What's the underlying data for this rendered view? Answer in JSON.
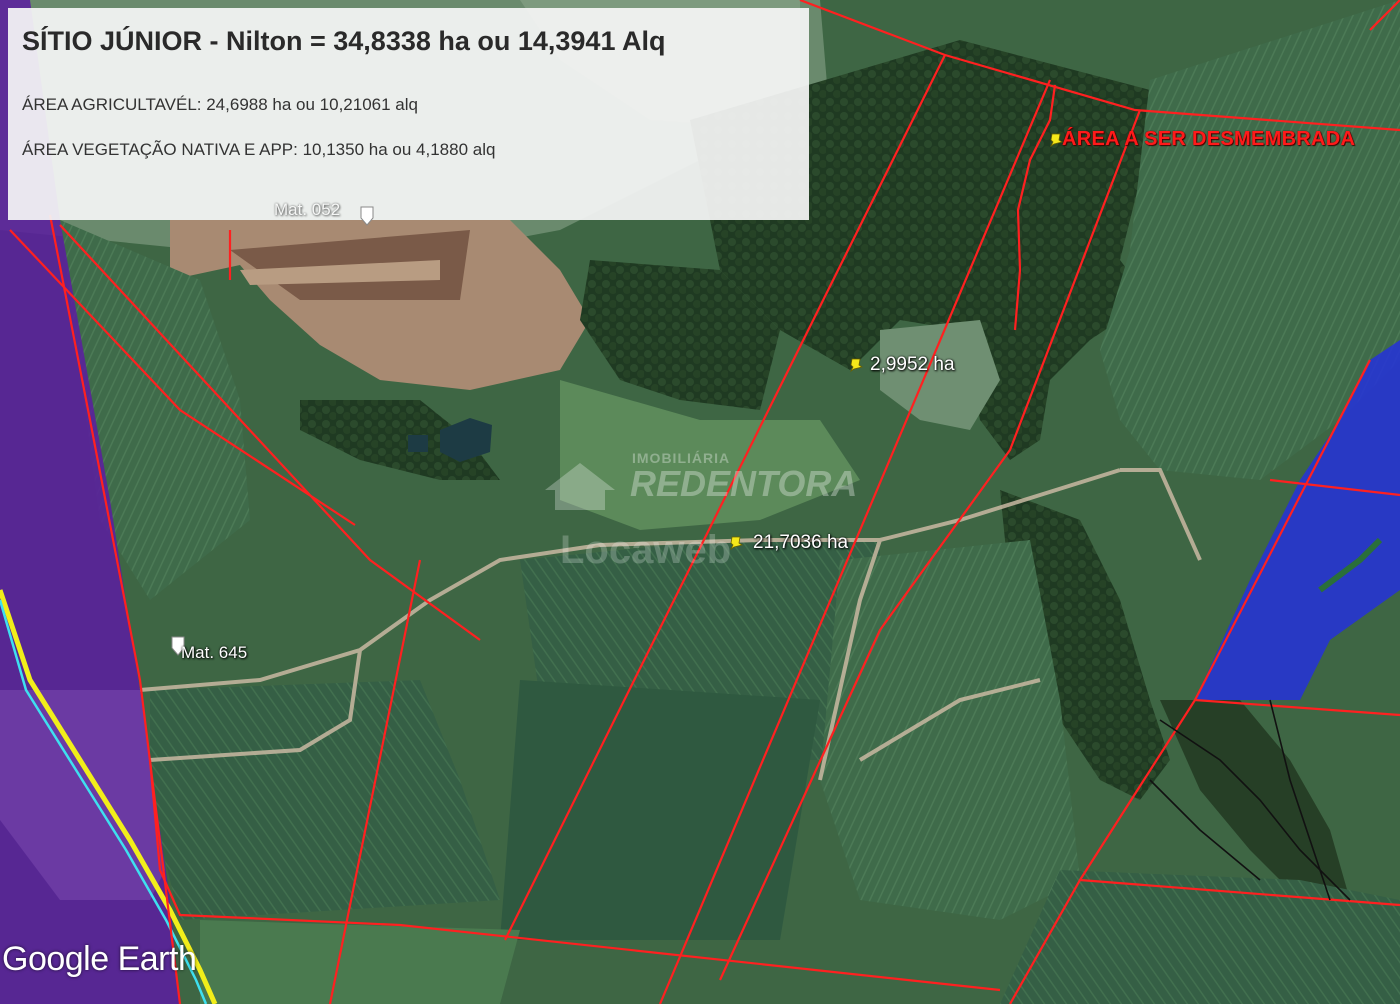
{
  "info_panel": {
    "title": "SÍTIO JÚNIOR - Nilton = 34,8338 ha ou 14,3941 Alq",
    "area_agricultavel": "ÁREA AGRICULTAVÉL: 24,6988 ha ou 10,21061 alq",
    "area_vegetacao": "ÁREA VEGETAÇÃO NATIVA E APP: 10,1350 ha ou 4,1880 alq"
  },
  "map": {
    "labels": {
      "mat_052": "Mat. 052",
      "mat_645": "Mat. 645",
      "area_2": "2,9952 ha",
      "area_21": "21,7036 ha",
      "desmembrada": "ÁREA A SER DESMEMBRADA"
    },
    "watermark": {
      "line1": "IMOBILIÁRIA",
      "line2": "REDENTORA",
      "line3": "Locaweb"
    },
    "colors": {
      "boundary": "#ff2020",
      "purple_zone": "#5b1f9e",
      "blue_zone": "#2633d6",
      "yellow_line": "#f2ee1a",
      "cyan_line": "#3ee0f0",
      "pin": "#f5e81a"
    }
  },
  "logo": {
    "text": "Google Earth"
  }
}
